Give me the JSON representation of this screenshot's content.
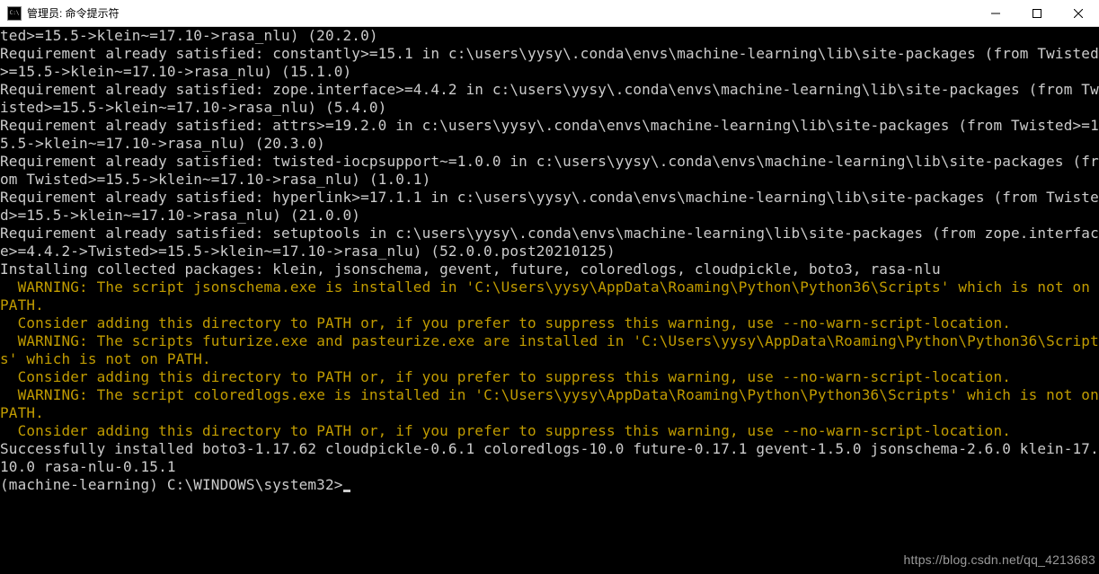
{
  "window": {
    "title": "管理员: 命令提示符"
  },
  "lines": [
    {
      "cls": "",
      "text": "ted>=15.5->klein~=17.10->rasa_nlu) (20.2.0)"
    },
    {
      "cls": "",
      "text": "Requirement already satisfied: constantly>=15.1 in c:\\users\\yysy\\.conda\\envs\\machine-learning\\lib\\site-packages (from Twisted>=15.5->klein~=17.10->rasa_nlu) (15.1.0)"
    },
    {
      "cls": "",
      "text": "Requirement already satisfied: zope.interface>=4.4.2 in c:\\users\\yysy\\.conda\\envs\\machine-learning\\lib\\site-packages (from Twisted>=15.5->klein~=17.10->rasa_nlu) (5.4.0)"
    },
    {
      "cls": "",
      "text": "Requirement already satisfied: attrs>=19.2.0 in c:\\users\\yysy\\.conda\\envs\\machine-learning\\lib\\site-packages (from Twisted>=15.5->klein~=17.10->rasa_nlu) (20.3.0)"
    },
    {
      "cls": "",
      "text": "Requirement already satisfied: twisted-iocpsupport~=1.0.0 in c:\\users\\yysy\\.conda\\envs\\machine-learning\\lib\\site-packages (from Twisted>=15.5->klein~=17.10->rasa_nlu) (1.0.1)"
    },
    {
      "cls": "",
      "text": "Requirement already satisfied: hyperlink>=17.1.1 in c:\\users\\yysy\\.conda\\envs\\machine-learning\\lib\\site-packages (from Twisted>=15.5->klein~=17.10->rasa_nlu) (21.0.0)"
    },
    {
      "cls": "",
      "text": "Requirement already satisfied: setuptools in c:\\users\\yysy\\.conda\\envs\\machine-learning\\lib\\site-packages (from zope.interface>=4.4.2->Twisted>=15.5->klein~=17.10->rasa_nlu) (52.0.0.post20210125)"
    },
    {
      "cls": "",
      "text": "Installing collected packages: klein, jsonschema, gevent, future, coloredlogs, cloudpickle, boto3, rasa-nlu"
    },
    {
      "cls": "warn",
      "text": "  WARNING: The script jsonschema.exe is installed in 'C:\\Users\\yysy\\AppData\\Roaming\\Python\\Python36\\Scripts' which is not on PATH."
    },
    {
      "cls": "warn",
      "text": "  Consider adding this directory to PATH or, if you prefer to suppress this warning, use --no-warn-script-location."
    },
    {
      "cls": "warn",
      "text": "  WARNING: The scripts futurize.exe and pasteurize.exe are installed in 'C:\\Users\\yysy\\AppData\\Roaming\\Python\\Python36\\Scripts' which is not on PATH."
    },
    {
      "cls": "warn",
      "text": "  Consider adding this directory to PATH or, if you prefer to suppress this warning, use --no-warn-script-location."
    },
    {
      "cls": "warn",
      "text": "  WARNING: The script coloredlogs.exe is installed in 'C:\\Users\\yysy\\AppData\\Roaming\\Python\\Python36\\Scripts' which is not on PATH."
    },
    {
      "cls": "warn",
      "text": "  Consider adding this directory to PATH or, if you prefer to suppress this warning, use --no-warn-script-location."
    },
    {
      "cls": "",
      "text": "Successfully installed boto3-1.17.62 cloudpickle-0.6.1 coloredlogs-10.0 future-0.17.1 gevent-1.5.0 jsonschema-2.6.0 klein-17.10.0 rasa-nlu-0.15.1"
    },
    {
      "cls": "",
      "text": ""
    }
  ],
  "prompt": "(machine-learning) C:\\WINDOWS\\system32>",
  "watermark": "https://blog.csdn.net/qq_4213683"
}
